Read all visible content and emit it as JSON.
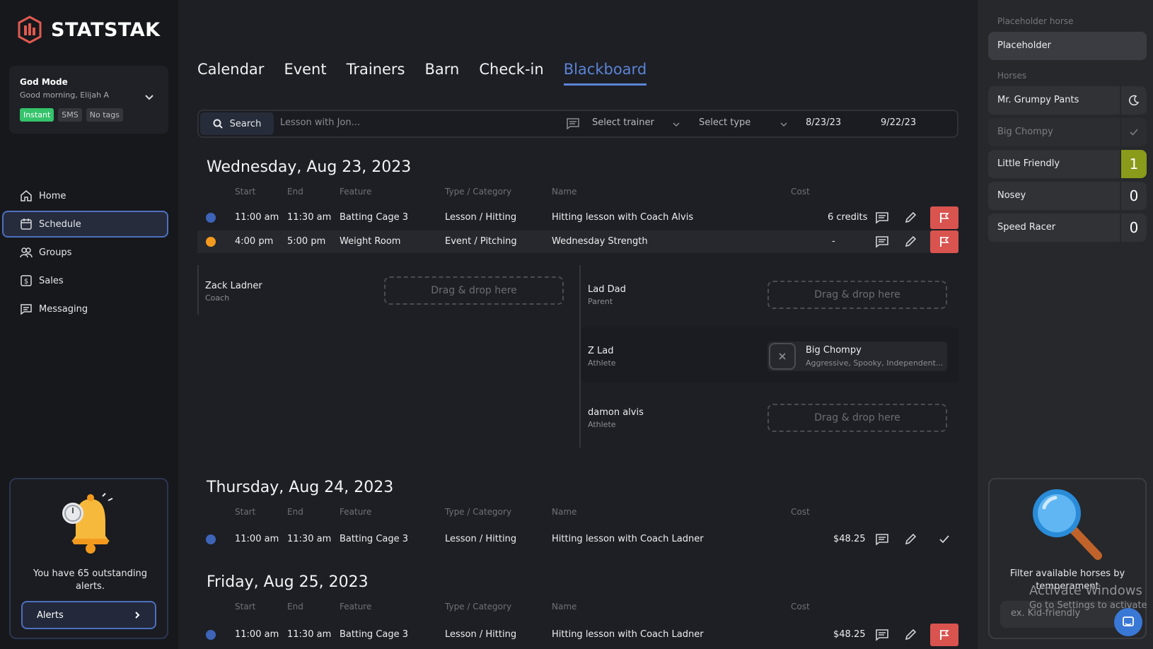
{
  "brand": {
    "name": "STATSTAK",
    "accent": "#e05a4f"
  },
  "profile": {
    "mode": "God Mode",
    "greeting": "Good morning, Elijah A",
    "tags": [
      "Instant",
      "SMS",
      "No tags"
    ]
  },
  "nav": [
    {
      "label": "Home",
      "icon": "home-icon"
    },
    {
      "label": "Schedule",
      "icon": "calendar-icon",
      "active": true
    },
    {
      "label": "Groups",
      "icon": "groups-icon"
    },
    {
      "label": "Sales",
      "icon": "dollar-icon"
    },
    {
      "label": "Messaging",
      "icon": "message-icon"
    }
  ],
  "alerts": {
    "message": "You have 65 outstanding alerts.",
    "button": "Alerts"
  },
  "tabs": [
    "Calendar",
    "Event",
    "Trainers",
    "Barn",
    "Check-in",
    "Blackboard"
  ],
  "active_tab": "Blackboard",
  "search": {
    "button": "Search",
    "placeholder": "Lesson with Jon...",
    "trainer": "Select trainer",
    "type": "Select type",
    "date_from": "8/23/23",
    "date_to": "9/22/23"
  },
  "columns": {
    "start": "Start",
    "end": "End",
    "feature": "Feature",
    "type": "Type / Category",
    "name": "Name",
    "cost": "Cost"
  },
  "days": [
    {
      "title": "Wednesday, Aug 23, 2023",
      "rows": [
        {
          "start": "11:00 am",
          "end": "11:30 am",
          "feature": "Batting Cage 3",
          "type": "Lesson / Hitting",
          "name": "Hitting lesson with Coach Alvis",
          "cost": "6 credits",
          "dot": "#3d64b8",
          "action": "flag"
        },
        {
          "start": "4:00 pm",
          "end": "5:00 pm",
          "feature": "Weight Room",
          "type": "Event / Pitching",
          "name": "Wednesday Strength",
          "cost": "-",
          "dot": "#f39a1e",
          "action": "flag"
        }
      ]
    },
    {
      "title": "Thursday, Aug 24, 2023",
      "rows": [
        {
          "start": "11:00 am",
          "end": "11:30 am",
          "feature": "Batting Cage 3",
          "type": "Lesson / Hitting",
          "name": "Hitting lesson with Coach Ladner",
          "cost": "$48.25",
          "dot": "#3d64b8",
          "action": "check"
        }
      ]
    },
    {
      "title": "Friday, Aug 25, 2023",
      "rows": [
        {
          "start": "11:00 am",
          "end": "11:30 am",
          "feature": "Batting Cage 3",
          "type": "Lesson / Hitting",
          "name": "Hitting lesson with Coach Ladner",
          "cost": "$48.25",
          "dot": "#3d64b8",
          "action": "flag"
        }
      ]
    }
  ],
  "expanded": {
    "coach": {
      "name": "Zack Ladner",
      "role": "Coach"
    },
    "dropzone": "Drag & drop here",
    "participants": [
      {
        "name": "Lad Dad",
        "role": "Parent"
      },
      {
        "name": "Z Lad",
        "role": "Athlete",
        "horse": {
          "name": "Big Chompy",
          "traits": "Aggressive, Spooky, Independent..."
        }
      },
      {
        "name": "damon alvis",
        "role": "Athlete"
      }
    ]
  },
  "right_panel": {
    "placeholder_label": "Placeholder horse",
    "placeholder_value": "Placeholder",
    "horses_label": "Horses",
    "horses": [
      {
        "name": "Mr. Grumpy Pants",
        "side": "moon-icon"
      },
      {
        "name": "Big Chompy",
        "side": "check-icon",
        "dim": true
      },
      {
        "name": "Little Friendly",
        "count": "1",
        "highlight": "#8a9a1a"
      },
      {
        "name": "Nosey",
        "count": "0"
      },
      {
        "name": "Speed Racer",
        "count": "0"
      }
    ],
    "filter_text": "Filter available horses by temperament",
    "filter_placeholder": "ex. Kid-friendly"
  },
  "watermark": {
    "line1": "Activate Windows",
    "line2": "Go to Settings to activate"
  }
}
